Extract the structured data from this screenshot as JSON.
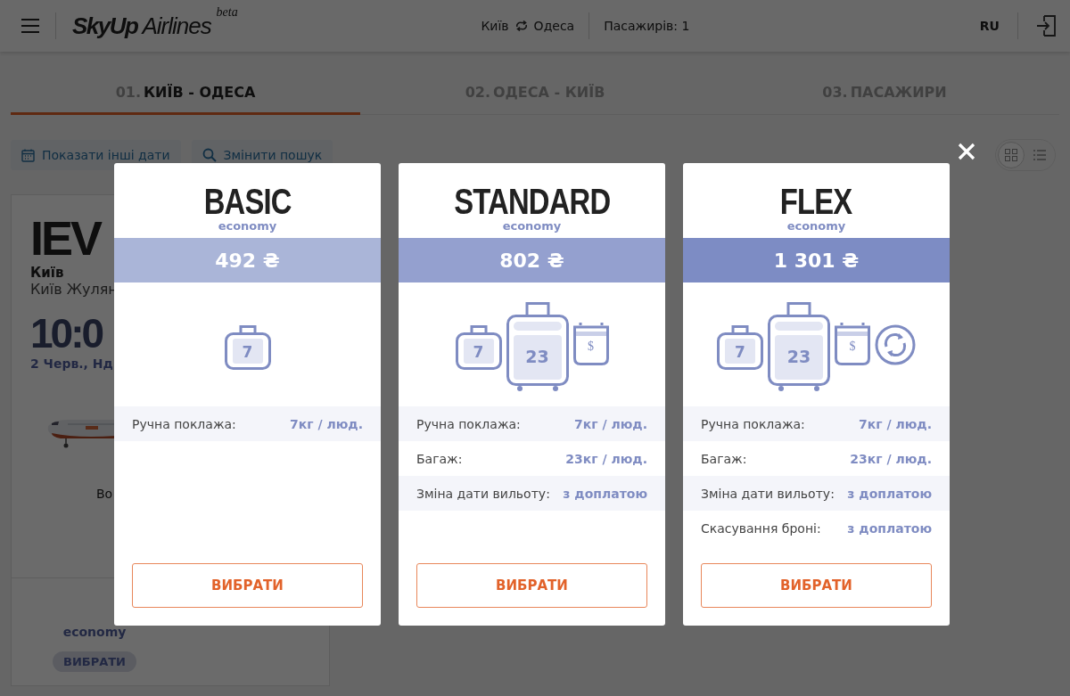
{
  "header": {
    "brand": "SkyUp",
    "brand_word": "Airlines",
    "badge": "beta",
    "route_from": "Київ",
    "route_to": "Одеса",
    "passengers": "Пасажирів: 1",
    "language": "RU"
  },
  "tabs": [
    {
      "number": "01.",
      "label": "КИЇВ - ОДЕСА",
      "selected": true
    },
    {
      "number": "02.",
      "label": "ОДЕСА - КИЇВ",
      "selected": false
    },
    {
      "number": "03.",
      "label": "ПАСАЖИРИ",
      "selected": false
    }
  ],
  "actions": [
    {
      "kind": "calendar",
      "label": "Показати інші дати"
    },
    {
      "kind": "search",
      "label": "Змінити пошук"
    }
  ],
  "view_modes": [
    {
      "kind": "grid",
      "selected": true
    },
    {
      "kind": "list",
      "selected": false
    }
  ],
  "flight": {
    "code": "IEV",
    "city": "Київ",
    "airport": "Київ Жулян",
    "time": "10:0",
    "date": "2 Черв., Нд",
    "note": "Во",
    "fare_class": "economy",
    "button": "ВИБРАТИ"
  },
  "modal": {
    "tiers": [
      {
        "name": "BASIC",
        "subtitle": "economy",
        "price": "492 ₴",
        "color": "#aab5d8",
        "icons": [
          {
            "kind": "hand",
            "label": "7"
          }
        ],
        "features": [
          {
            "label": "Ручна поклажа:",
            "value": "7кг / люд."
          }
        ],
        "button": "ВИБРАТИ"
      },
      {
        "name": "STANDARD",
        "subtitle": "economy",
        "price": "802 ₴",
        "color": "#94a0cf",
        "icons": [
          {
            "kind": "hand",
            "label": "7"
          },
          {
            "kind": "suitcase",
            "label": "23"
          },
          {
            "kind": "insurance",
            "label": "$"
          }
        ],
        "features": [
          {
            "label": "Ручна поклажа:",
            "value": "7кг / люд."
          },
          {
            "label": "Багаж:",
            "value": "23кг / люд."
          },
          {
            "label": "Зміна дати вильоту:",
            "value": "з доплатою"
          }
        ],
        "button": "ВИБРАТИ"
      },
      {
        "name": "FLEX",
        "subtitle": "economy",
        "price": "1 301 ₴",
        "color": "#7d8cc4",
        "icons": [
          {
            "kind": "hand",
            "label": "7"
          },
          {
            "kind": "suitcase",
            "label": "23"
          },
          {
            "kind": "insurance",
            "label": "$"
          },
          {
            "kind": "refresh"
          }
        ],
        "features": [
          {
            "label": "Ручна поклажа:",
            "value": "7кг / люд."
          },
          {
            "label": "Багаж:",
            "value": "23кг / люд."
          },
          {
            "label": "Зміна дати вильоту:",
            "value": "з доплатою"
          },
          {
            "label": "Скасування броні:",
            "value": "з доплатою"
          }
        ],
        "button": "ВИБРАТИ"
      }
    ]
  }
}
